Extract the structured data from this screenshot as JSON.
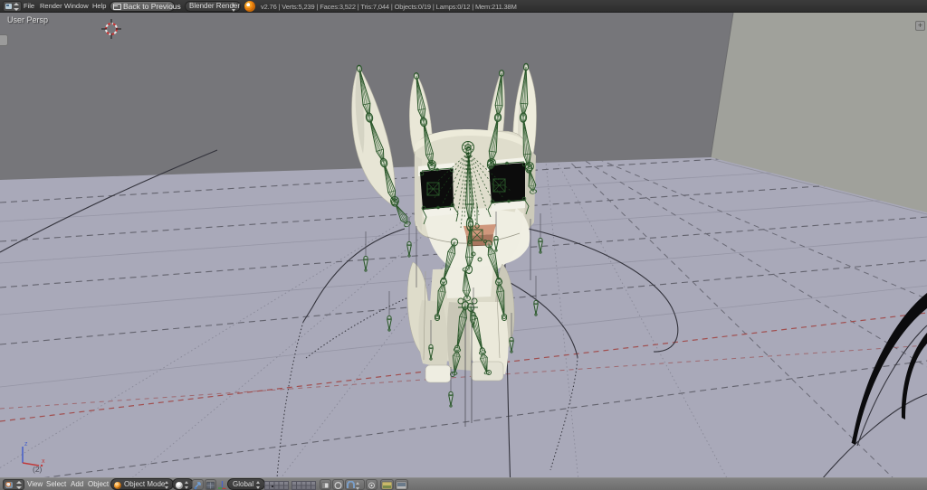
{
  "topbar": {
    "menus": [
      "File",
      "Render",
      "Window",
      "Help"
    ],
    "back_label": "Back to Previous",
    "engine": "Blender Render",
    "stats": "v2.76 | Verts:5,239 | Faces:3,522 | Tris:7,044 | Objects:0/19 | Lamps:0/12 | Mem:211.38M"
  },
  "viewport": {
    "label": "User Persp",
    "layer_count": "(2)",
    "axis_x_label": "x",
    "axis_z_label": "z",
    "plus_label": "+"
  },
  "bottombar": {
    "menus": [
      "View",
      "Select",
      "Add",
      "Object"
    ],
    "mode": "Object Mode",
    "orientation": "Global"
  },
  "colors": {
    "floor": "#a9a9b9",
    "wall_dark": "#76767a",
    "wall_light": "#a0a19b",
    "body_cream": "#e3e1d1",
    "bone_green": "#2a572a",
    "axis_red": "#a14e4e",
    "accent_orange": "#e87d0d"
  }
}
